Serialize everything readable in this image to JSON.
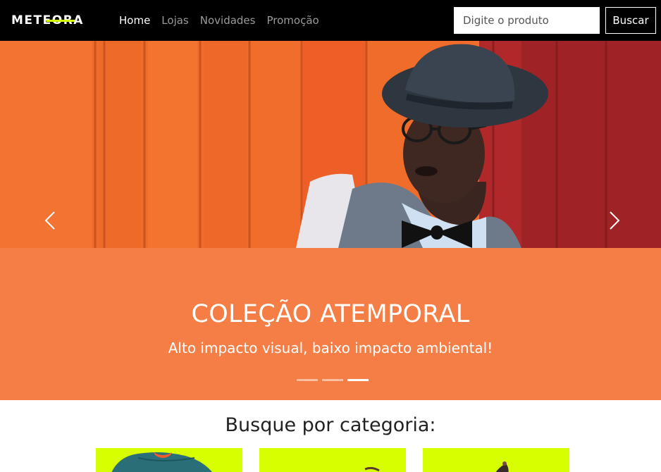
{
  "brand": {
    "name": "METEORA",
    "accent_color": "#d7ff00"
  },
  "nav": {
    "items": [
      {
        "label": "Home",
        "active": true
      },
      {
        "label": "Lojas",
        "active": false
      },
      {
        "label": "Novidades",
        "active": false
      },
      {
        "label": "Promoção",
        "active": false
      }
    ]
  },
  "search": {
    "placeholder": "Digite o produto",
    "button_label": "Buscar"
  },
  "hero": {
    "title": "COLEÇÃO ATEMPORAL",
    "subtitle": "Alto impacto visual, baixo impacto ambiental!",
    "background_color": "#f47e45",
    "slides_count": 3,
    "active_slide": 3
  },
  "categories": {
    "heading": "Busque por categoria:",
    "card_color": "#d7ff00"
  },
  "icons": [
    "chevron-left-icon",
    "chevron-right-icon"
  ]
}
